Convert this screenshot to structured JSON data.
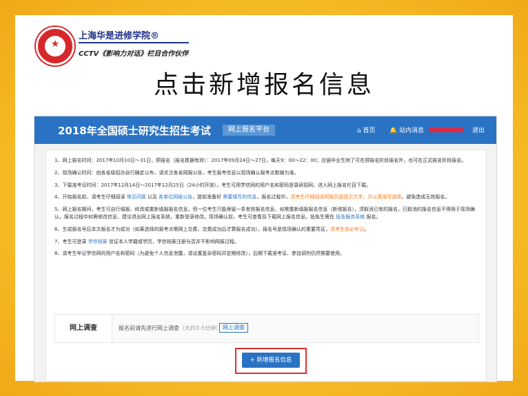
{
  "slide": {
    "brand_main": "上海华是进修学院®",
    "brand_sub": "CCTV《影响力对话》栏目合作伙伴",
    "headline": "点击新增报名信息"
  },
  "header": {
    "system_title": "2018年全国硕士研究生招生考试",
    "platform_tag": "网上报名平台",
    "nav_home": "⌂ 首页",
    "nav_messages": "🔔 站内消息",
    "nav_exit": "退出"
  },
  "notices": [
    {
      "parts": [
        {
          "text": "1、网上报名时间：2017年10月10日～31日，预报名（报名数据有效）：2017年09月24日～27日，每天9：00～22：00；应届毕业生除了可在预报名阶段报名外，也可在正式报名阶段报名。"
        }
      ]
    },
    {
      "parts": [
        {
          "text": "2、现场确认时间：由各省级招办自行确定公布，请关注各省网报公告，考生报考信息以现场确认报考点数据为准。"
        }
      ]
    },
    {
      "parts": [
        {
          "text": "3、下载准考证时间：2017年12月14日～2017年12月25日（24小时开放），考生可用学信网的用户名和密码登录研招网，进入网上报名栏目下载。"
        }
      ]
    },
    {
      "parts": [
        {
          "text": "4、开始报名前，请考生仔细阅读 "
        },
        {
          "text": "常见问题",
          "style": "lnk"
        },
        {
          "text": " 以及 "
        },
        {
          "text": "各单位网报公告",
          "style": "lnk"
        },
        {
          "text": "，提前准备好 "
        },
        {
          "text": "需要填写的信息",
          "style": "lnk"
        },
        {
          "text": "，报名过程中，"
        },
        {
          "text": "请考生仔细阅读网报页面提示文字，并认真填写选择",
          "style": "hl"
        },
        {
          "text": "，避免造成无效报名。"
        }
      ]
    },
    {
      "parts": [
        {
          "text": "5、网上报名期间，考生可自行填报、修改或重新填报报名信息，但一位考生只能保留一条有效报名信息。如需重新填报报名信息（新增报名），须取消已有的报名，已取消的报名信息不得用于现场确认。报名过程中如需修改信息，建议退出网上报名系统，重新登录修改。现场确认前，考生可查看及下载网上报名信息。抵免生需在 "
        },
        {
          "text": "抵免服务系统",
          "style": "lnk"
        },
        {
          "text": " 报名。"
        }
      ]
    },
    {
      "parts": [
        {
          "text": "6、生成报名号后本次报名才为成功（如果选择的报考点需网上交费，交费成功后才算报名成功），报名号是现场确认的重要凭证，"
        },
        {
          "text": "请考生务必牢记",
          "style": "hl"
        },
        {
          "text": "。"
        }
      ]
    },
    {
      "parts": [
        {
          "text": "7、考生可登录 "
        },
        {
          "text": "学信档案",
          "style": "lnk"
        },
        {
          "text": " 验证本人学籍或学历，学信档案注册与否并不影响网报过程。"
        }
      ]
    },
    {
      "parts": [
        {
          "text": "8、请考生牢记学信网的用户名和密码（为避免个人信息泄露，请设置复杂密码并定期修改），后期下载准考证、参加调剂仍然需要使用。"
        }
      ]
    }
  ],
  "survey": {
    "label": "网上调查",
    "text": "报名前请先进行网上调查",
    "hint": "（大约3-5分钟）",
    "link": "网上调查"
  },
  "actions": {
    "add_button": "+ 新增报名信息"
  },
  "colors": {
    "accent": "#2a73c4",
    "highlight": "#ff7a1a",
    "outline": "#e02a2a",
    "frame": "#f6c12a"
  }
}
